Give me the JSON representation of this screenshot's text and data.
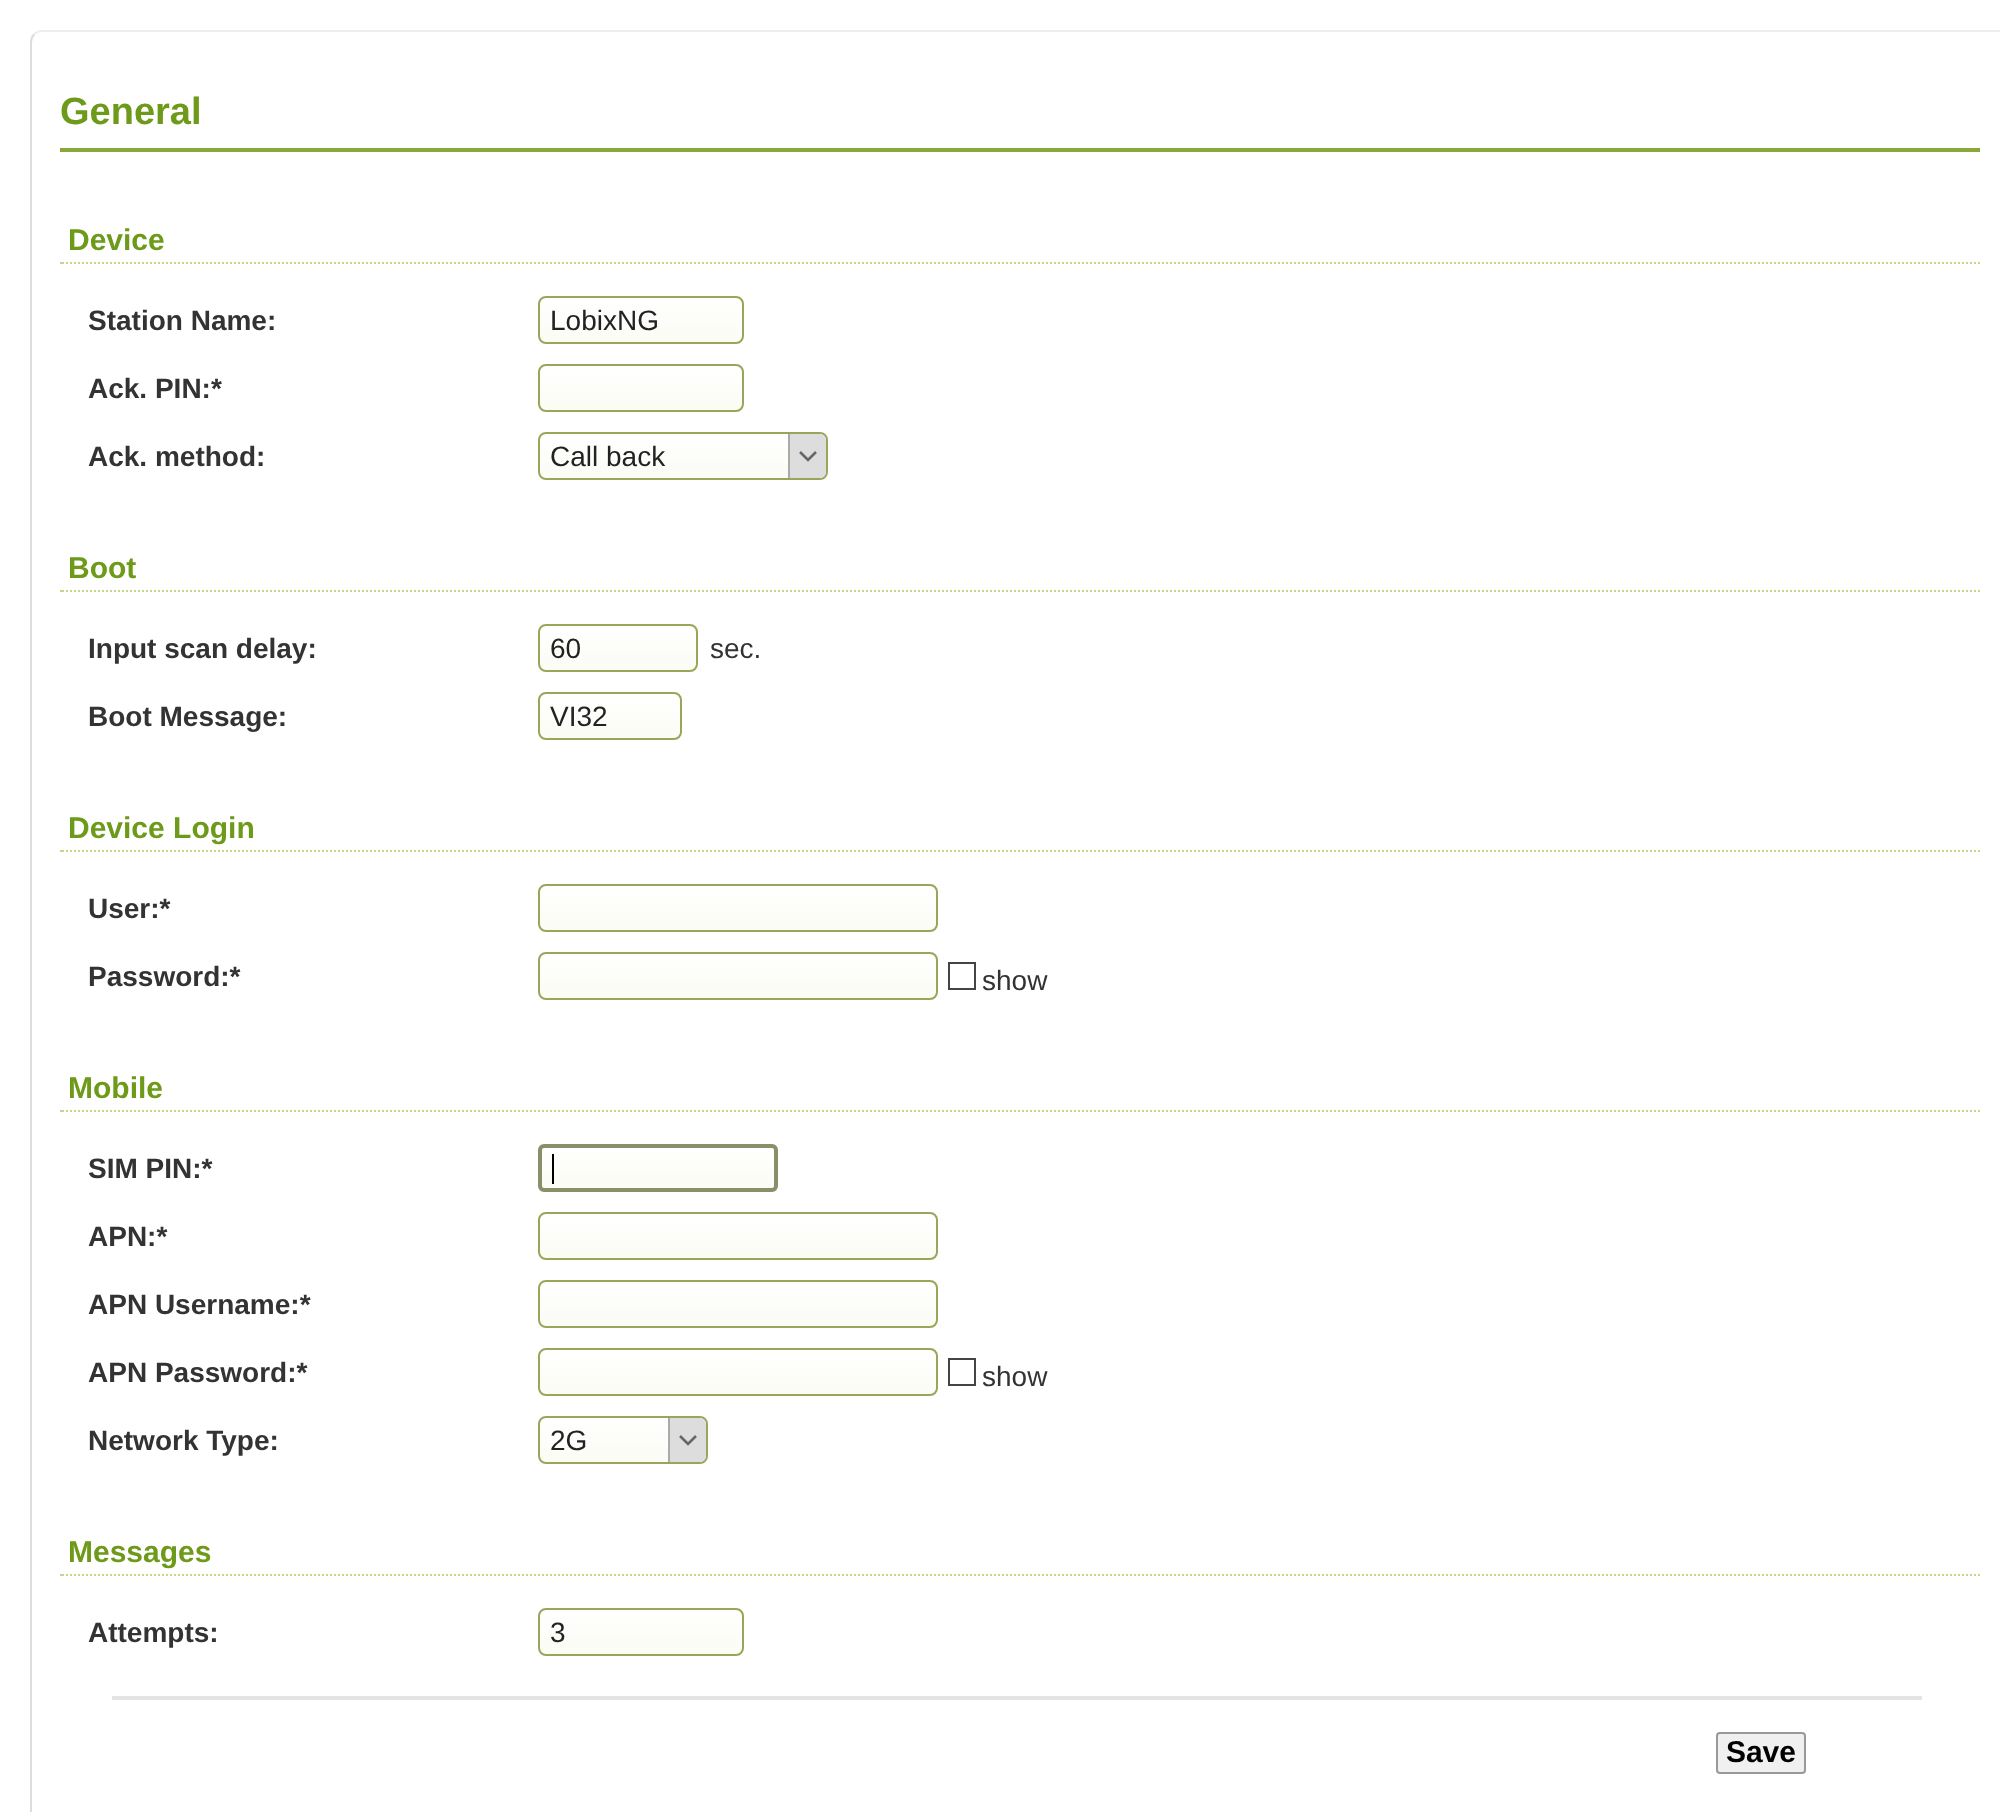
{
  "title": "General",
  "sections": [
    {
      "heading": "Device",
      "fields": [
        {
          "label": "Station Name:",
          "kind": "text",
          "value": "LobixNG",
          "focused": false
        },
        {
          "label": "Ack. PIN:*",
          "kind": "text",
          "focused": false
        },
        {
          "label": "Ack. method:",
          "kind": "select",
          "value": "Call back",
          "focused": false
        }
      ]
    },
    {
      "heading": "Boot",
      "fields": [
        {
          "label": "Input scan delay:",
          "kind": "text",
          "value": "60",
          "unit": "sec.",
          "focused": false
        },
        {
          "label": "Boot Message:",
          "kind": "text",
          "value": "VI32",
          "focused": false
        }
      ]
    },
    {
      "heading": "Device Login",
      "fields": [
        {
          "label": "User:*",
          "kind": "text",
          "focused": false
        },
        {
          "label": "Password:*",
          "kind": "text",
          "focused": false,
          "show": {
            "label": "show",
            "checked": false
          }
        }
      ]
    },
    {
      "heading": "Mobile",
      "fields": [
        {
          "label": "SIM PIN:*",
          "kind": "text",
          "focused": true
        },
        {
          "label": "APN:*",
          "kind": "text",
          "focused": false
        },
        {
          "label": "APN Username:*",
          "kind": "text",
          "focused": false
        },
        {
          "label": "APN Password:*",
          "kind": "text",
          "focused": false,
          "show": {
            "label": "show",
            "checked": false
          }
        },
        {
          "label": "Network Type:",
          "kind": "select",
          "value": "2G",
          "focused": false
        }
      ]
    },
    {
      "heading": "Messages",
      "fields": [
        {
          "label": "Attempts:",
          "kind": "text",
          "value": "3",
          "focused": false
        }
      ]
    }
  ],
  "save_button": "Save"
}
